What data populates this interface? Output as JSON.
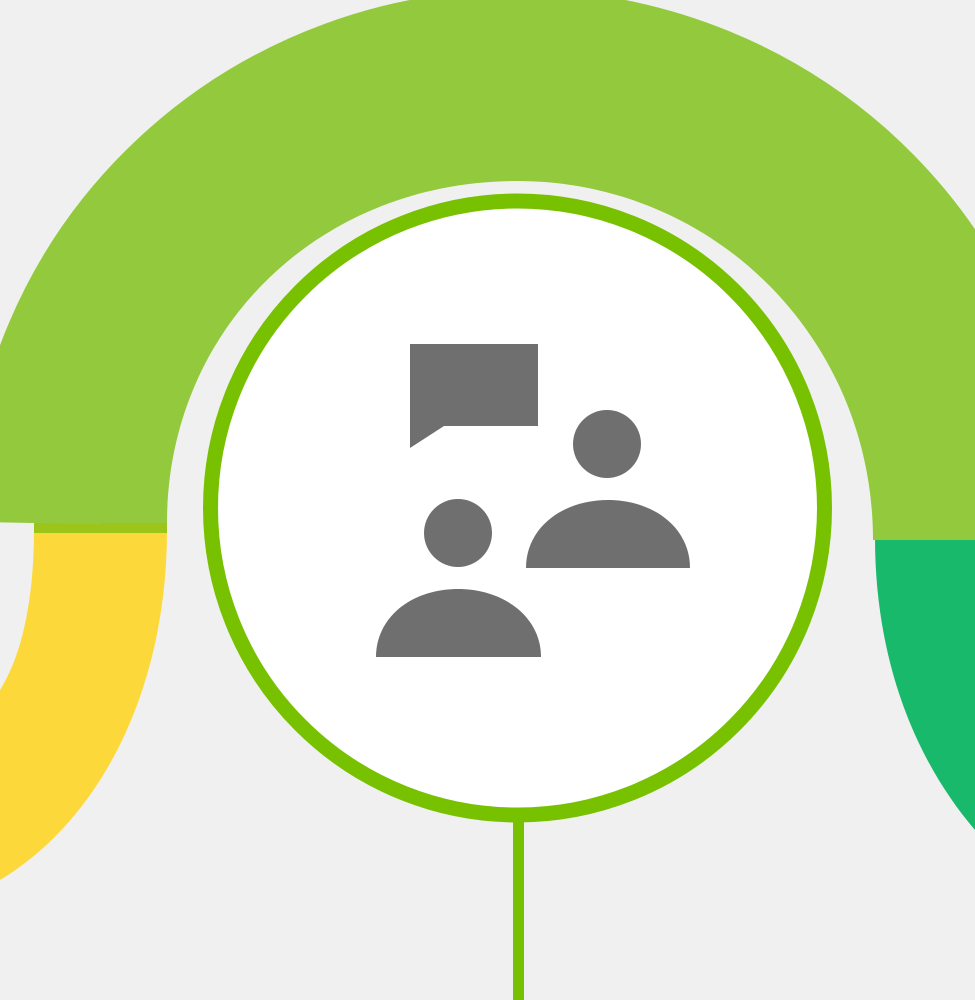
{
  "diagram": {
    "segments": [
      {
        "name": "left-segment",
        "color": "#fdd83a"
      },
      {
        "name": "top-arc",
        "color": "#93c93d"
      },
      {
        "name": "right-segment",
        "color": "#19b96b"
      }
    ],
    "node": {
      "icon": "conversation-people-icon",
      "ring_color": "#78c101",
      "fill_color": "#ffffff",
      "icon_color": "#6f6f6f"
    },
    "connector_color": "#78c101",
    "background": "#f0f0f0"
  }
}
